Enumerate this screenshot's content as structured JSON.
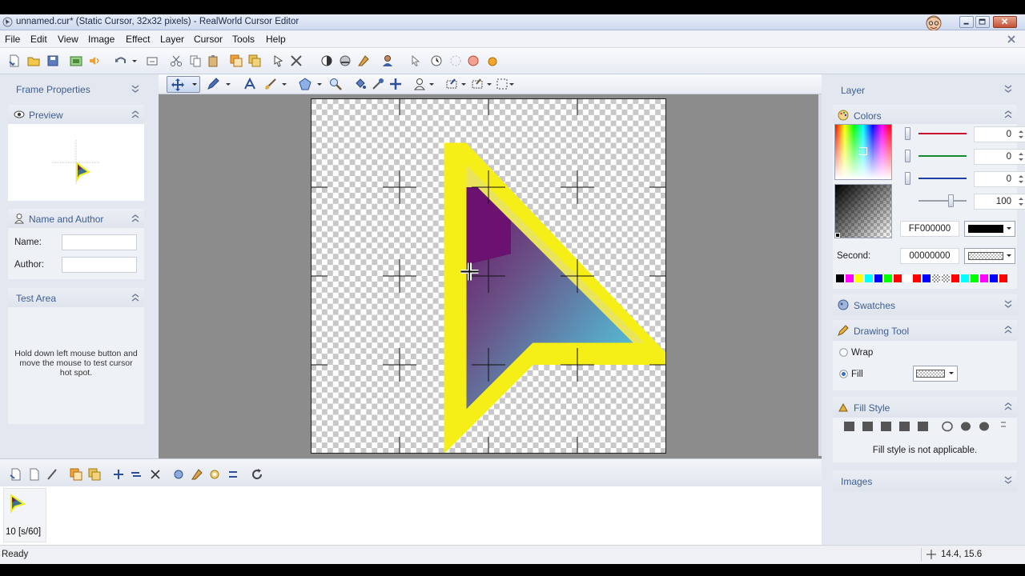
{
  "window": {
    "title": "unnamed.cur* (Static Cursor, 32x32 pixels) - RealWorld Cursor Editor",
    "minimize": "0",
    "maximize": "1",
    "close": "r"
  },
  "menu": [
    "File",
    "Edit",
    "View",
    "Image",
    "Effect",
    "Layer",
    "Cursor",
    "Tools",
    "Help"
  ],
  "left_panels": {
    "frame_properties": "Frame Properties",
    "preview": "Preview",
    "name_author": {
      "title": "Name and Author",
      "name_label": "Name:",
      "name_value": "",
      "author_label": "Author:",
      "author_value": ""
    },
    "test_area": {
      "title": "Test Area",
      "hint": "Hold down left mouse button and move the mouse to test cursor hot spot."
    }
  },
  "right_panels": {
    "layer": "Layer",
    "colors": {
      "title": "Colors",
      "red": "0",
      "green": "0",
      "blue": "0",
      "alpha": "100",
      "primary_hex": "FF000000",
      "second_label": "Second:",
      "second_hex": "00000000",
      "channel_colors": [
        "#c8102e",
        "#128a2f",
        "#1c3fa8",
        "#9aa0aa"
      ]
    },
    "palette": [
      "#000000",
      "#ff00ff",
      "#ffff00",
      "#00ffff",
      "#0000ff",
      "#00ff00",
      "#ff0000",
      "#ffffff",
      "#ff0000",
      "#0000ff",
      "checker",
      "checker",
      "#ff0000",
      "#00ffff",
      "#00ff00",
      "#ff00ff",
      "#0000ff",
      "#ff0000"
    ],
    "swatches": "Swatches",
    "drawing_tool": {
      "title": "Drawing Tool",
      "wrap": "Wrap",
      "fill": "Fill",
      "selected": "Fill"
    },
    "fill_style": {
      "title": "Fill Style",
      "message": "Fill style is not applicable."
    },
    "images": "Images"
  },
  "frames": [
    {
      "label": "10 [s/60]"
    }
  ],
  "status": {
    "text": "Ready",
    "coords": "14.4, 15.6"
  }
}
